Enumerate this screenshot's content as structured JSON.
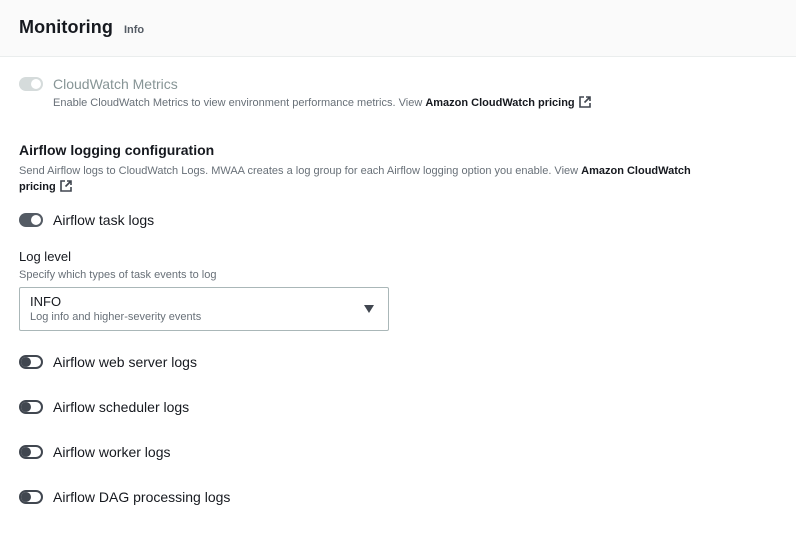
{
  "header": {
    "title": "Monitoring",
    "info_label": "Info"
  },
  "cloudwatch": {
    "label": "CloudWatch Metrics",
    "enabled": true,
    "disabled": true,
    "description": "Enable CloudWatch Metrics to view environment performance metrics. View ",
    "link_text": "Amazon CloudWatch pricing"
  },
  "logging": {
    "title": "Airflow logging configuration",
    "description": "Send Airflow logs to CloudWatch Logs. MWAA creates a log group for each Airflow logging option you enable. View ",
    "link_text_line1": "Amazon CloudWatch",
    "link_text_line2": "pricing",
    "task_logs": {
      "label": "Airflow task logs",
      "enabled": true
    },
    "log_level": {
      "label": "Log level",
      "description": "Specify which types of task events to log",
      "selected_value": "INFO",
      "selected_description": "Log info and higher-severity events"
    },
    "web_server_logs": {
      "label": "Airflow web server logs",
      "enabled": false
    },
    "scheduler_logs": {
      "label": "Airflow scheduler logs",
      "enabled": false
    },
    "worker_logs": {
      "label": "Airflow worker logs",
      "enabled": false
    },
    "dag_processing_logs": {
      "label": "Airflow DAG processing logs",
      "enabled": false
    }
  },
  "colors": {
    "text": "#16191f",
    "muted": "#687078",
    "toggle_on": "#545b64",
    "toggle_disabled": "#d5dbdb"
  },
  "icons": [
    "external-link-icon",
    "caret-down-icon"
  ]
}
